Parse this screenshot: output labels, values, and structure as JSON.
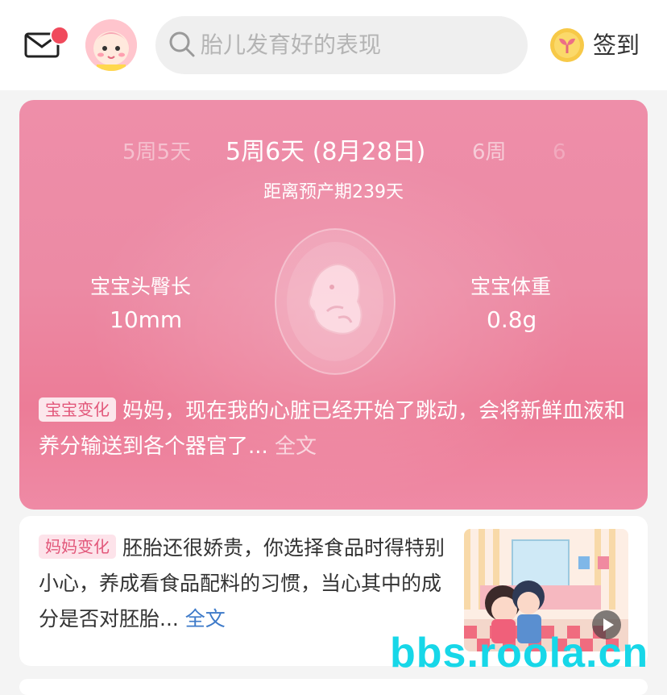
{
  "header": {
    "search_placeholder": "胎儿发育好的表现",
    "checkin_label": "签到",
    "mail_icon": "mail-icon",
    "avatar_icon": "baby-avatar",
    "coin_icon": "sprout-coin-icon"
  },
  "week_carousel": {
    "prev": "5周5天",
    "current": "5周6天 (8月28日)",
    "next": "6周",
    "next2": "6"
  },
  "due_text": "距离预产期239天",
  "stats": {
    "crl_label": "宝宝头臀长",
    "crl_value": "10mm",
    "weight_label": "宝宝体重",
    "weight_value": "0.8g"
  },
  "baby_change": {
    "tag": "宝宝变化",
    "text": "妈妈，现在我的心脏已经开始了跳动，会将新鲜血液和养分输送到各个器官了...",
    "more": " 全文"
  },
  "mom_change": {
    "tag": "妈妈变化",
    "text": "胚胎还很娇贵，你选择食品时得特别小心，养成看食品配料的习惯，当心其中的成分是否对胚胎...",
    "more": " 全文"
  },
  "watermark": "bbs.roola.cn",
  "colors": {
    "card_pink": "#ec8aa4",
    "accent_red": "#f04a5c",
    "link_blue": "#3d7ac9",
    "watermark_cyan": "#17d7e8"
  }
}
